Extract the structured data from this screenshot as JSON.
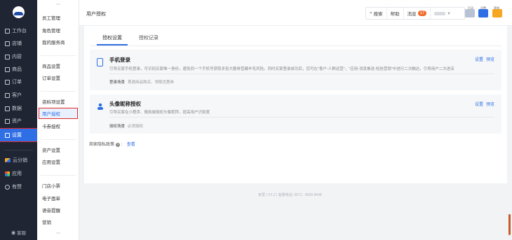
{
  "sidebar": {
    "logo_icon": "bird-logo-icon",
    "items": [
      {
        "label": "工作台",
        "icon": "monitor-icon"
      },
      {
        "label": "店铺",
        "icon": "store-icon"
      },
      {
        "label": "内容",
        "icon": "content-icon"
      },
      {
        "label": "商品",
        "icon": "goods-icon"
      },
      {
        "label": "订单",
        "icon": "order-icon"
      },
      {
        "label": "客户",
        "icon": "customer-icon"
      },
      {
        "label": "数据",
        "icon": "chart-icon"
      },
      {
        "label": "资产",
        "icon": "asset-icon"
      },
      {
        "label": "设置",
        "icon": "gear-icon"
      },
      {
        "label": "云分销",
        "icon": "cloud-icon"
      },
      {
        "label": "应用",
        "icon": "apps-icon"
      },
      {
        "label": "有赞",
        "icon": "like-icon"
      }
    ],
    "service_label": "客服",
    "active_index": 8
  },
  "subnav": {
    "items": [
      {
        "label": "员工管理"
      },
      {
        "label": "角色管理"
      },
      {
        "label": "我的服务商"
      },
      {
        "label": "商品设置"
      },
      {
        "label": "订单设置"
      },
      {
        "label": "资料项设置"
      },
      {
        "label": "用户授权"
      },
      {
        "label": "卡券授权"
      },
      {
        "label": "资产设置"
      },
      {
        "label": "应用设置"
      },
      {
        "label": "门店小票"
      },
      {
        "label": "电子面单"
      },
      {
        "label": "语音提醒"
      },
      {
        "label": "营销"
      }
    ],
    "active_index": 6
  },
  "topbar": {
    "page_title": "用户授权",
    "search_label": "搜索",
    "help_label": "帮助",
    "messages_label": "消息",
    "messages_count": "17",
    "tool_labels": [
      "打印",
      "设置",
      "营销"
    ]
  },
  "tabs": [
    {
      "label": "授权设置"
    },
    {
      "label": "授权记录"
    }
  ],
  "cards": [
    {
      "title": "手机登录",
      "icon": "phone-icon",
      "desc": "引导买家手机登录，可识别买家唯一身份，避免同一个手机号获取多张大额券营薅羊毛风险。同时买家登录成功后，您可在\"客户-人群运营\"，\"应用-消息推送-短信营销\"中进行二次触达，引导用户二次进店",
      "meta_label": "登录场景",
      "meta_value": "首遇商品购买、领取优惠券",
      "links": [
        "设置",
        "预览"
      ]
    },
    {
      "title": "头像昵称授权",
      "icon": "avatar-icon",
      "desc": "引导买家在小程序、微商城授权头像昵称，提高用户识别度",
      "meta_label": "授权场景",
      "meta_value": "必须授权",
      "links": [
        "设置",
        "预览"
      ]
    }
  ],
  "policy": {
    "label": "商家隐私政策",
    "link": "查看"
  },
  "footer": "有赞 | YZ.2 | 客服电话: 0571 - 8699 8648",
  "colors": {
    "accent": "#2f6fe6",
    "sidebar_bg": "#1f2533",
    "highlight": "#e02a2a",
    "badge": "#f06b2b"
  }
}
